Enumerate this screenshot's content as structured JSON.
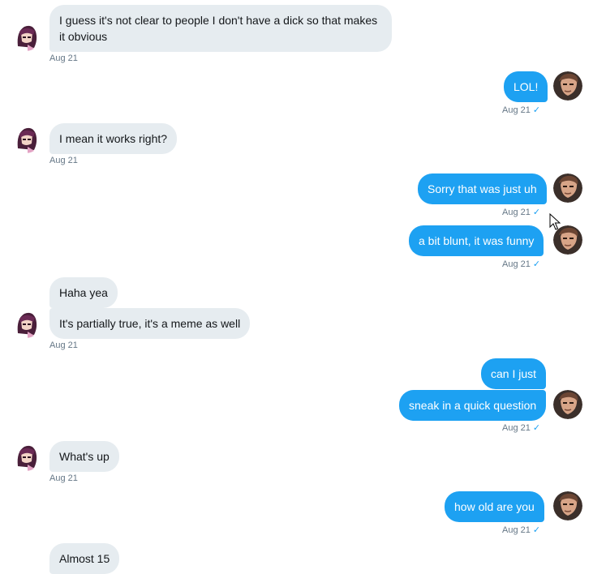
{
  "messages": [
    {
      "text": "I guess it's not clear to people I don't have a dick so that makes it obvious",
      "time": "Aug 21"
    },
    {
      "text": "LOL!",
      "time": "Aug 21"
    },
    {
      "text": "I mean it works right?",
      "time": "Aug 21"
    },
    {
      "text": "Sorry that was just uh",
      "time": "Aug 21"
    },
    {
      "text": "a bit blunt, it was funny",
      "time": "Aug 21"
    },
    {
      "text": "Haha yea"
    },
    {
      "text": "It's partially true, it's a meme as well",
      "time": "Aug 21"
    },
    {
      "text": "can I just"
    },
    {
      "text": "sneak in a quick question",
      "time": "Aug 21"
    },
    {
      "text": "What's up",
      "time": "Aug 21"
    },
    {
      "text": "how old are you",
      "time": "Aug 21"
    },
    {
      "text": "Almost 15"
    }
  ],
  "read_receipt_icon": "checkmark-icon",
  "colors": {
    "incoming_bg": "#e6ecf0",
    "outgoing_bg": "#1da1f2",
    "meta": "#657786"
  }
}
